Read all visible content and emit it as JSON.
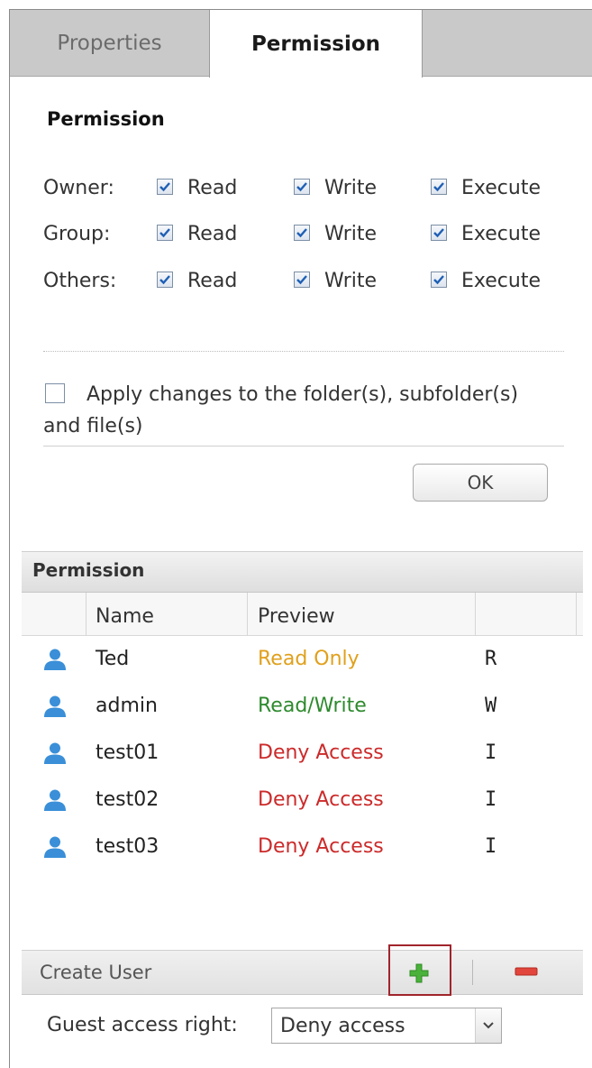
{
  "tabs": [
    {
      "label": "Properties",
      "active": false
    },
    {
      "label": "Permission",
      "active": true
    }
  ],
  "unix_permissions": {
    "heading": "Permission",
    "rows": [
      {
        "label": "Owner:",
        "read": "Read",
        "write": "Write",
        "execute": "Execute"
      },
      {
        "label": "Group:",
        "read": "Read",
        "write": "Write",
        "execute": "Execute"
      },
      {
        "label": "Others:",
        "read": "Read",
        "write": "Write",
        "execute": "Execute"
      }
    ],
    "apply_label": "Apply changes to the folder(s), subfolder(s) and file(s)",
    "ok_label": "OK"
  },
  "user_permissions": {
    "title": "Permission",
    "columns": [
      "Name",
      "Preview"
    ],
    "users": [
      {
        "name": "Ted",
        "preview": "Read Only",
        "code": "R",
        "preview_color": "#e0a01c"
      },
      {
        "name": "admin",
        "preview": "Read/Write",
        "code": "W",
        "preview_color": "#2d8a2d"
      },
      {
        "name": "test01",
        "preview": "Deny Access",
        "code": "I",
        "preview_color": "#cc2a2a"
      },
      {
        "name": "test02",
        "preview": "Deny Access",
        "code": "I",
        "preview_color": "#cc2a2a"
      },
      {
        "name": "test03",
        "preview": "Deny Access",
        "code": "I",
        "preview_color": "#cc2a2a"
      }
    ]
  },
  "create_user": {
    "label": "Create User"
  },
  "guest": {
    "label": "Guest access right:",
    "value": "Deny access"
  },
  "icons": {
    "user": "user-icon",
    "add": "plus-icon",
    "remove": "minus-icon",
    "dropdown": "chevron-down-icon",
    "checkbox": "check-icon"
  },
  "colors": {
    "accent": "#3a8fd8",
    "add": "#4ab23a",
    "remove": "#e2453c"
  }
}
